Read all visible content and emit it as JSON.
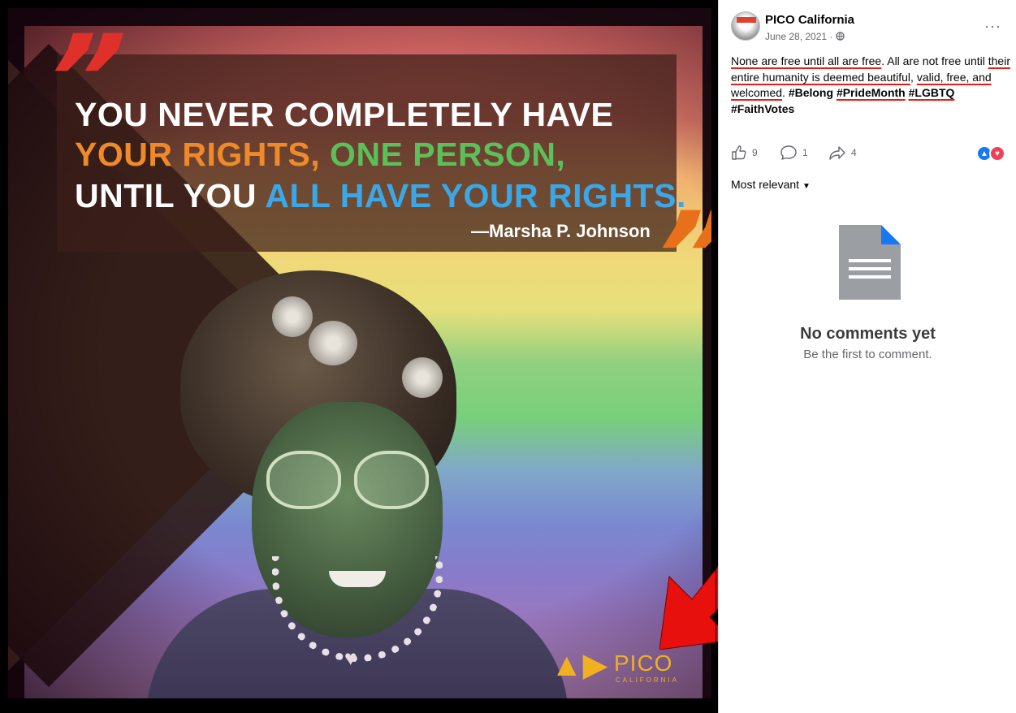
{
  "poster": {
    "quote_line1": "YOU NEVER COMPLETELY HAVE",
    "quote_line2_part1": "YOUR RIGHTS,",
    "quote_line2_part2": "ONE PERSON,",
    "quote_line3_part1": "UNTIL YOU",
    "quote_line3_part2": "ALL HAVE  YOUR RIGHTS.",
    "attribution": "—Marsha P. Johnson",
    "logo_word": "PICO",
    "logo_sub": "CALIFORNIA",
    "colors": {
      "quote_red": "#e0302a",
      "quote_orange": "#e8701a",
      "green": "#5cc05a",
      "blue": "#3aa8e8",
      "logo_gold": "#f0b020"
    }
  },
  "post": {
    "page_name": "PICO California",
    "date": "June 28, 2021 ·",
    "more_label": "···",
    "text": {
      "s1": "None are free until all are free",
      "s2": ". All are not free until ",
      "s3": "their entire humanity is deemed beautiful",
      "s4": ", ",
      "s5": "valid, free, and welcomed",
      "s6": ". ",
      "h1": "#Belong",
      "h2": "#PrideMonth",
      "h3": "#LGBTQ",
      "h4": "#FaithVotes"
    },
    "likes": "9",
    "comments": "1",
    "shares": "4",
    "sort_label": "Most relevant",
    "no_comments_title": "No comments yet",
    "no_comments_sub": "Be the first to comment.",
    "colors": {
      "underline": "#e0201a",
      "like_blue": "#1877f2",
      "love_red": "#f33e58"
    }
  }
}
